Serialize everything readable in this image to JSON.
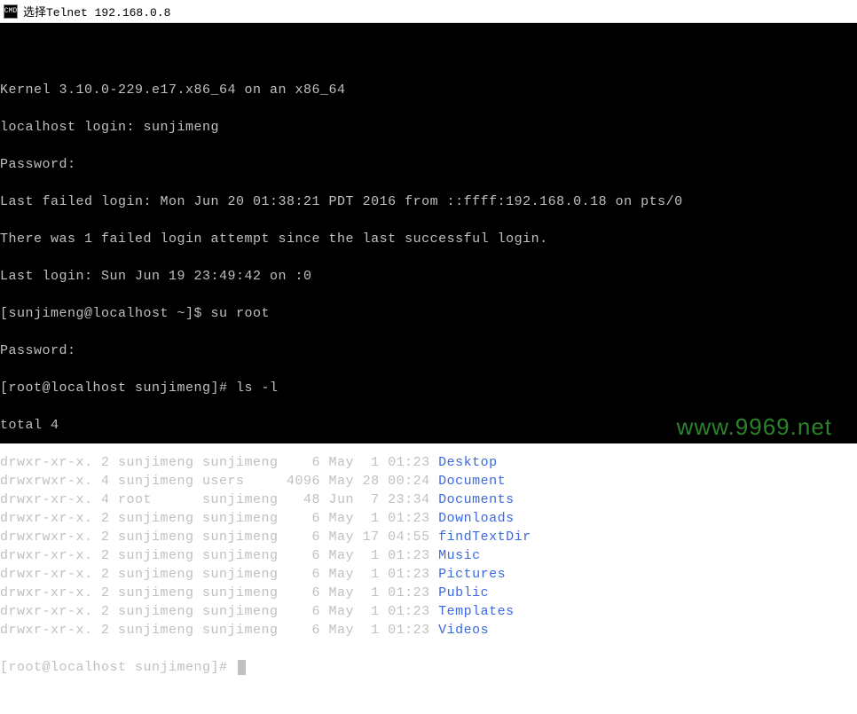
{
  "window": {
    "icon_label": "CMD",
    "title": "选择Telnet 192.168.0.8"
  },
  "terminal": {
    "kernel_line": "Kernel 3.10.0-229.e17.x86_64 on an x86_64",
    "login_prompt": "localhost login: sunjimeng",
    "password_prompt1": "Password:",
    "last_failed": "Last failed login: Mon Jun 20 01:38:21 PDT 2016 from ::ffff:192.168.0.18 on pts/0",
    "failed_attempt": "There was 1 failed login attempt since the last successful login.",
    "last_login": "Last login: Sun Jun 19 23:49:42 on :0",
    "user_prompt": "[sunjimeng@localhost ~]$ su root",
    "password_prompt2": "Password:",
    "root_prompt_ls": "[root@localhost sunjimeng]# ls -l",
    "total_line": "total 4",
    "listing": [
      {
        "perms": "drwxr-xr-x.",
        "links": "2",
        "owner": "sunjimeng",
        "group": "sunjimeng",
        "size": "   6",
        "month": "May",
        "day": " 1",
        "time": "01:23",
        "name": "Desktop"
      },
      {
        "perms": "drwxrwxr-x.",
        "links": "4",
        "owner": "sunjimeng",
        "group": "users    ",
        "size": "4096",
        "month": "May",
        "day": "28",
        "time": "00:24",
        "name": "Document"
      },
      {
        "perms": "drwxr-xr-x.",
        "links": "4",
        "owner": "root     ",
        "group": "sunjimeng",
        "size": "  48",
        "month": "Jun",
        "day": " 7",
        "time": "23:34",
        "name": "Documents"
      },
      {
        "perms": "drwxr-xr-x.",
        "links": "2",
        "owner": "sunjimeng",
        "group": "sunjimeng",
        "size": "   6",
        "month": "May",
        "day": " 1",
        "time": "01:23",
        "name": "Downloads"
      },
      {
        "perms": "drwxrwxr-x.",
        "links": "2",
        "owner": "sunjimeng",
        "group": "sunjimeng",
        "size": "   6",
        "month": "May",
        "day": "17",
        "time": "04:55",
        "name": "findTextDir"
      },
      {
        "perms": "drwxr-xr-x.",
        "links": "2",
        "owner": "sunjimeng",
        "group": "sunjimeng",
        "size": "   6",
        "month": "May",
        "day": " 1",
        "time": "01:23",
        "name": "Music"
      },
      {
        "perms": "drwxr-xr-x.",
        "links": "2",
        "owner": "sunjimeng",
        "group": "sunjimeng",
        "size": "   6",
        "month": "May",
        "day": " 1",
        "time": "01:23",
        "name": "Pictures"
      },
      {
        "perms": "drwxr-xr-x.",
        "links": "2",
        "owner": "sunjimeng",
        "group": "sunjimeng",
        "size": "   6",
        "month": "May",
        "day": " 1",
        "time": "01:23",
        "name": "Public"
      },
      {
        "perms": "drwxr-xr-x.",
        "links": "2",
        "owner": "sunjimeng",
        "group": "sunjimeng",
        "size": "   6",
        "month": "May",
        "day": " 1",
        "time": "01:23",
        "name": "Templates"
      },
      {
        "perms": "drwxr-xr-x.",
        "links": "2",
        "owner": "sunjimeng",
        "group": "sunjimeng",
        "size": "   6",
        "month": "May",
        "day": " 1",
        "time": "01:23",
        "name": "Videos"
      }
    ],
    "final_prompt": "[root@localhost sunjimeng]# "
  },
  "watermark": "www.9969.net"
}
